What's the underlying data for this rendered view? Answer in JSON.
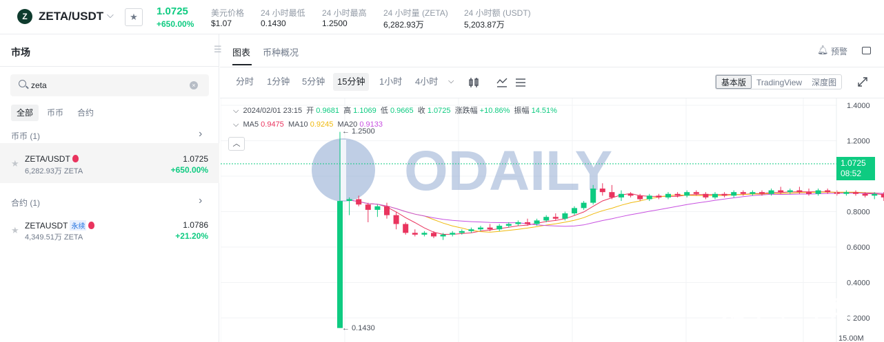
{
  "header": {
    "logo_letter": "Z",
    "pair": "ZETA/USDT",
    "price": "1.0725",
    "change": "+650.00%",
    "stats": [
      {
        "label": "美元价格",
        "value": "$1.07"
      },
      {
        "label": "24 小时最低",
        "value": "0.1430"
      },
      {
        "label": "24 小时最高",
        "value": "1.2500"
      },
      {
        "label": "24 小时量 (ZETA)",
        "value": "6,282.93万"
      },
      {
        "label": "24 小时额 (USDT)",
        "value": "5,203.87万"
      }
    ]
  },
  "sidebar": {
    "title": "市场",
    "search": "zeta",
    "filters": [
      "全部",
      "币币",
      "合约"
    ],
    "spot_section": "币币 (1)",
    "spot_item": {
      "symbol": "ZETA/USDT",
      "volume": "6,282.93万 ZETA",
      "price": "1.0725",
      "change": "+650.00%"
    },
    "futures_section": "合约 (1)",
    "futures_item": {
      "symbol": "ZETAUSDT",
      "tag": "永续",
      "volume": "4,349.51万 ZETA",
      "price": "1.0786",
      "change": "+21.20%"
    }
  },
  "main": {
    "tabs": [
      "图表",
      "币种概况"
    ],
    "alert": "预警",
    "timeframes": [
      "分时",
      "1分钟",
      "5分钟",
      "15分钟",
      "1小时",
      "4小时"
    ],
    "views": [
      "基本版",
      "TradingView",
      "深度图"
    ]
  },
  "ohlc": {
    "date": "2024/02/01 23:15",
    "open_label": "开",
    "open": "0.9681",
    "high_label": "高",
    "high": "1.1069",
    "low_label": "低",
    "low": "0.9665",
    "close_label": "收",
    "close": "1.0725",
    "chg_label": "涨跌幅",
    "chg": "+10.86%",
    "amp_label": "振幅",
    "amp": "14.51%"
  },
  "ma": {
    "ma5_label": "MA5",
    "ma5": "0.9475",
    "ma10_label": "MA10",
    "ma10": "0.9245",
    "ma20_label": "MA20",
    "ma20": "0.9133"
  },
  "chart_data": {
    "type": "candlestick",
    "y_ticks": [
      "1.4000",
      "1.2000",
      "1.0000",
      "0.8000",
      "0.6000",
      "0.4000",
      "0.2000"
    ],
    "ylim": [
      0.1,
      1.45
    ],
    "high_label": "← 1.2500",
    "low_label": "← 0.1430",
    "last_price": "1.0725",
    "countdown": "08:52",
    "bottom_label": "15.00M",
    "colors": {
      "up": "#0ecb81",
      "down": "#e9345e",
      "ma5": "#e9345e",
      "ma10": "#f0b90b",
      "ma20": "#c74fe0"
    },
    "candles": [
      [
        0.143,
        1.25,
        0.143,
        0.86
      ],
      [
        0.86,
        0.88,
        0.78,
        0.87
      ],
      [
        0.87,
        0.89,
        0.83,
        0.84
      ],
      [
        0.84,
        0.85,
        0.74,
        0.81
      ],
      [
        0.81,
        0.84,
        0.77,
        0.83
      ],
      [
        0.83,
        0.85,
        0.76,
        0.78
      ],
      [
        0.78,
        0.8,
        0.7,
        0.73
      ],
      [
        0.73,
        0.74,
        0.67,
        0.68
      ],
      [
        0.68,
        0.7,
        0.66,
        0.67
      ],
      [
        0.67,
        0.69,
        0.66,
        0.68
      ],
      [
        0.68,
        0.69,
        0.65,
        0.66
      ],
      [
        0.66,
        0.68,
        0.64,
        0.67
      ],
      [
        0.67,
        0.69,
        0.66,
        0.68
      ],
      [
        0.68,
        0.7,
        0.67,
        0.69
      ],
      [
        0.69,
        0.71,
        0.68,
        0.7
      ],
      [
        0.7,
        0.72,
        0.69,
        0.71
      ],
      [
        0.71,
        0.73,
        0.69,
        0.7
      ],
      [
        0.7,
        0.73,
        0.69,
        0.72
      ],
      [
        0.72,
        0.74,
        0.71,
        0.73
      ],
      [
        0.73,
        0.75,
        0.72,
        0.74
      ],
      [
        0.74,
        0.76,
        0.72,
        0.73
      ],
      [
        0.73,
        0.76,
        0.72,
        0.75
      ],
      [
        0.75,
        0.78,
        0.74,
        0.77
      ],
      [
        0.77,
        0.79,
        0.75,
        0.76
      ],
      [
        0.76,
        0.8,
        0.75,
        0.79
      ],
      [
        0.79,
        0.83,
        0.78,
        0.82
      ],
      [
        0.82,
        0.86,
        0.81,
        0.85
      ],
      [
        0.85,
        0.95,
        0.84,
        0.93
      ],
      [
        0.93,
        0.96,
        0.89,
        0.91
      ],
      [
        0.91,
        0.95,
        0.87,
        0.88
      ],
      [
        0.88,
        0.92,
        0.86,
        0.9
      ],
      [
        0.9,
        0.91,
        0.88,
        0.89
      ],
      [
        0.89,
        0.9,
        0.86,
        0.87
      ],
      [
        0.87,
        0.9,
        0.86,
        0.89
      ],
      [
        0.89,
        0.9,
        0.87,
        0.88
      ],
      [
        0.88,
        0.91,
        0.87,
        0.9
      ],
      [
        0.9,
        0.91,
        0.88,
        0.89
      ],
      [
        0.89,
        0.92,
        0.88,
        0.91
      ],
      [
        0.91,
        0.92,
        0.89,
        0.9
      ],
      [
        0.9,
        0.91,
        0.87,
        0.88
      ],
      [
        0.88,
        0.91,
        0.87,
        0.9
      ],
      [
        0.9,
        0.91,
        0.88,
        0.89
      ],
      [
        0.89,
        0.92,
        0.88,
        0.91
      ],
      [
        0.91,
        0.92,
        0.89,
        0.9
      ],
      [
        0.9,
        0.92,
        0.89,
        0.91
      ],
      [
        0.91,
        0.92,
        0.89,
        0.9
      ],
      [
        0.9,
        0.93,
        0.89,
        0.92
      ],
      [
        0.92,
        0.94,
        0.9,
        0.91
      ],
      [
        0.91,
        0.93,
        0.9,
        0.92
      ],
      [
        0.92,
        0.94,
        0.9,
        0.91
      ],
      [
        0.91,
        0.93,
        0.89,
        0.9
      ],
      [
        0.9,
        0.93,
        0.89,
        0.92
      ],
      [
        0.92,
        0.93,
        0.9,
        0.91
      ],
      [
        0.91,
        0.92,
        0.89,
        0.9
      ],
      [
        0.9,
        0.92,
        0.89,
        0.91
      ],
      [
        0.91,
        0.92,
        0.89,
        0.9
      ],
      [
        0.9,
        0.91,
        0.88,
        0.89
      ],
      [
        0.89,
        0.91,
        0.87,
        0.9
      ],
      [
        0.9,
        0.91,
        0.86,
        0.88
      ],
      [
        0.88,
        0.9,
        0.85,
        0.87
      ],
      [
        0.87,
        0.92,
        0.85,
        0.91
      ],
      [
        0.91,
        0.97,
        0.9,
        0.96
      ],
      [
        0.9681,
        1.1069,
        0.9665,
        1.0725
      ]
    ]
  }
}
